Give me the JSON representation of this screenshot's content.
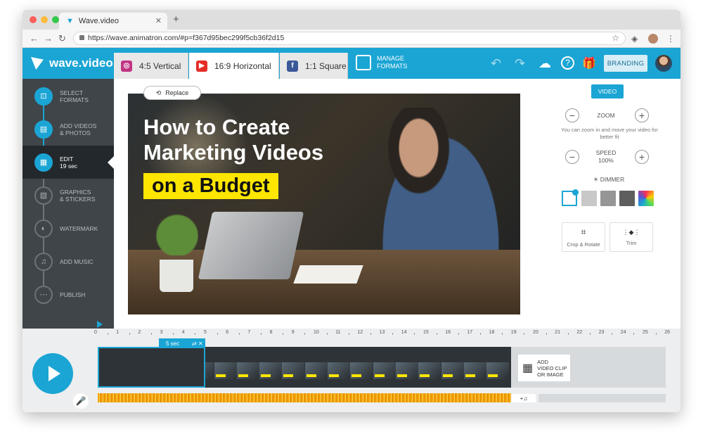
{
  "browser": {
    "tab_title": "Wave.video",
    "close_glyph": "✕",
    "new_tab_glyph": "+",
    "url": "https://wave.animatron.com/#p=f367d95bec299f5cb36f2d15",
    "back_glyph": "←",
    "forward_glyph": "→",
    "reload_glyph": "↻",
    "star_glyph": "☆",
    "menu_glyph": "⋮",
    "traffic_colors": [
      "#fc605c",
      "#fdbc40",
      "#34c84a"
    ]
  },
  "app": {
    "logo_text": "wave.video",
    "accent_color": "#1ba5d4",
    "format_tabs": [
      {
        "label": "4:5 Vertical",
        "icon": "instagram-icon",
        "icon_glyph": "◎",
        "icon_color": "#c13584"
      },
      {
        "label": "16:9 Horizontal",
        "icon": "youtube-icon",
        "icon_glyph": "▶",
        "icon_color": "#e52d27"
      },
      {
        "label": "1:1 Square",
        "icon": "facebook-icon",
        "icon_glyph": "f",
        "icon_color": "#3b5998"
      }
    ],
    "manage_formats_line1": "MANAGE",
    "manage_formats_line2": "FORMATS",
    "header_glyphs": {
      "undo": "↶",
      "redo": "↷",
      "cloud": "☁",
      "help": "?",
      "gift": "🎁"
    },
    "branding_label": "BRANDING"
  },
  "sidebar": {
    "items": [
      {
        "line1": "SELECT",
        "line2": "FORMATS",
        "glyph": "⊡"
      },
      {
        "line1": "ADD VIDEOS",
        "line2": "& PHOTOS",
        "glyph": "▤"
      },
      {
        "line1": "EDIT",
        "line2": "19 sec",
        "glyph": "▦"
      },
      {
        "line1": "GRAPHICS",
        "line2": "& STICKERS",
        "glyph": "▧"
      },
      {
        "line1": "WATERMARK",
        "line2": "",
        "glyph": "◐"
      },
      {
        "line1": "ADD MUSIC",
        "line2": "",
        "glyph": "♫"
      },
      {
        "line1": "PUBLISH",
        "line2": "",
        "glyph": "⋯"
      }
    ]
  },
  "canvas": {
    "replace_label": "Replace",
    "replace_glyph": "⟲",
    "title_line1": "How to Create",
    "title_line2": "Marketing Videos",
    "highlight": "on a Budget",
    "highlight_color": "#ffe600"
  },
  "right_panel": {
    "video_button": "VIDEO",
    "zoom_label": "ZOOM",
    "zoom_hint": "You can zoom in and move your video for better fit",
    "speed_label": "SPEED",
    "speed_value": "100%",
    "minus_glyph": "−",
    "plus_glyph": "+",
    "dimmer_label": "DIMMER",
    "dimmer_glyph": "☀",
    "dimmer_swatches": [
      "#ffffff",
      "#c8c8c8",
      "#969696",
      "#5e5e5e",
      "multicolor"
    ],
    "crop_label": "Crop & Rotate",
    "crop_glyph": "⌗",
    "trim_label": "Trim",
    "trim_glyph": "⋮◆⋮"
  },
  "timeline": {
    "ruler_ticks": [
      "0",
      "1",
      "2",
      "3",
      "4",
      "5",
      "6",
      "7",
      "8",
      "9",
      "10",
      "11",
      "12",
      "13",
      "14",
      "15",
      "16",
      "17",
      "18",
      "19",
      "20",
      "21",
      "22",
      "23",
      "24",
      "25",
      "26"
    ],
    "clip_duration": "5 sec",
    "clip_controls": "⇄ ✕",
    "add_clip_line1": "ADD",
    "add_clip_line2": "VIDEO CLIP",
    "add_clip_line3": "OR IMAGE",
    "add_clip_glyph": "▦",
    "music_button": "+♫",
    "mic_glyph": "🎤"
  }
}
